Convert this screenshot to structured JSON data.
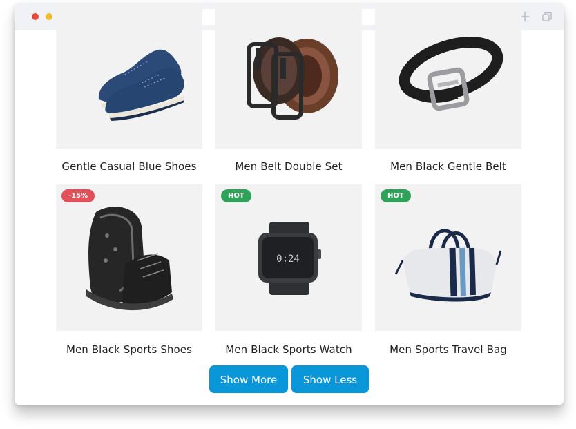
{
  "browser": {
    "address_value": "",
    "icons": [
      "back-arrow-icon",
      "forward-arrow-icon",
      "home-icon",
      "search-icon",
      "reload-icon",
      "new-tab-plus-icon",
      "tabs-icon"
    ]
  },
  "products": [
    {
      "name": "Gentle Casual Blue Shoes",
      "badge": null,
      "image": "blue-casual-shoes"
    },
    {
      "name": "Men Belt Double Set",
      "badge": null,
      "image": "double-belt-set"
    },
    {
      "name": "Men Black Gentle Belt",
      "badge": null,
      "image": "black-belt"
    },
    {
      "name": "Men Black Sports Shoes",
      "badge": "-15%",
      "image": "black-sports-boots"
    },
    {
      "name": "Men Black Sports Watch",
      "badge": "HOT",
      "image": "black-smart-watch"
    },
    {
      "name": "Men Sports Travel Bag",
      "badge": "HOT",
      "image": "travel-bag"
    }
  ],
  "actions": {
    "show_more": "Show More",
    "show_less": "Show Less"
  },
  "colors": {
    "button": "#0a97da",
    "badge_sale": "#e05058",
    "badge_hot": "#2fa25a",
    "card_bg": "#f2f2f3"
  }
}
